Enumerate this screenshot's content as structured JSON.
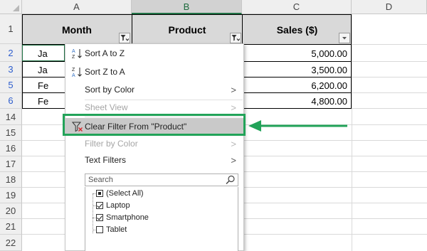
{
  "columns": [
    "A",
    "B",
    "C",
    "D"
  ],
  "rows": [
    "1",
    "2",
    "3",
    "5",
    "6",
    "14",
    "15",
    "16",
    "17",
    "18",
    "19",
    "20",
    "21",
    "22"
  ],
  "headers": {
    "month": "Month",
    "product": "Product",
    "sales": "Sales ($)"
  },
  "visible_cells": {
    "a2": "Ja",
    "a3": "Ja",
    "a5": "Fe",
    "a6": "Fe",
    "c2": "5,000.00",
    "c3": "3,500.00",
    "c5": "6,200.00",
    "c6": "4,800.00"
  },
  "menu": {
    "sort_az": "Sort A to Z",
    "sort_za": "Sort Z to A",
    "sort_by_color": "Sort by Color",
    "sheet_view": "Sheet View",
    "clear_filter": "Clear Filter From \"Product\"",
    "filter_by_color": "Filter by Color",
    "text_filters": "Text Filters",
    "search_placeholder": "Search",
    "chevron": ">"
  },
  "filter_list": [
    {
      "label": "(Select All)",
      "state": "partial"
    },
    {
      "label": "Laptop",
      "state": "checked"
    },
    {
      "label": "Smartphone",
      "state": "checked"
    },
    {
      "label": "Tablet",
      "state": "unchecked"
    }
  ],
  "colors": {
    "highlight_border": "#22a359",
    "excel_green": "#217346",
    "filtered_row": "#2f5fce"
  }
}
